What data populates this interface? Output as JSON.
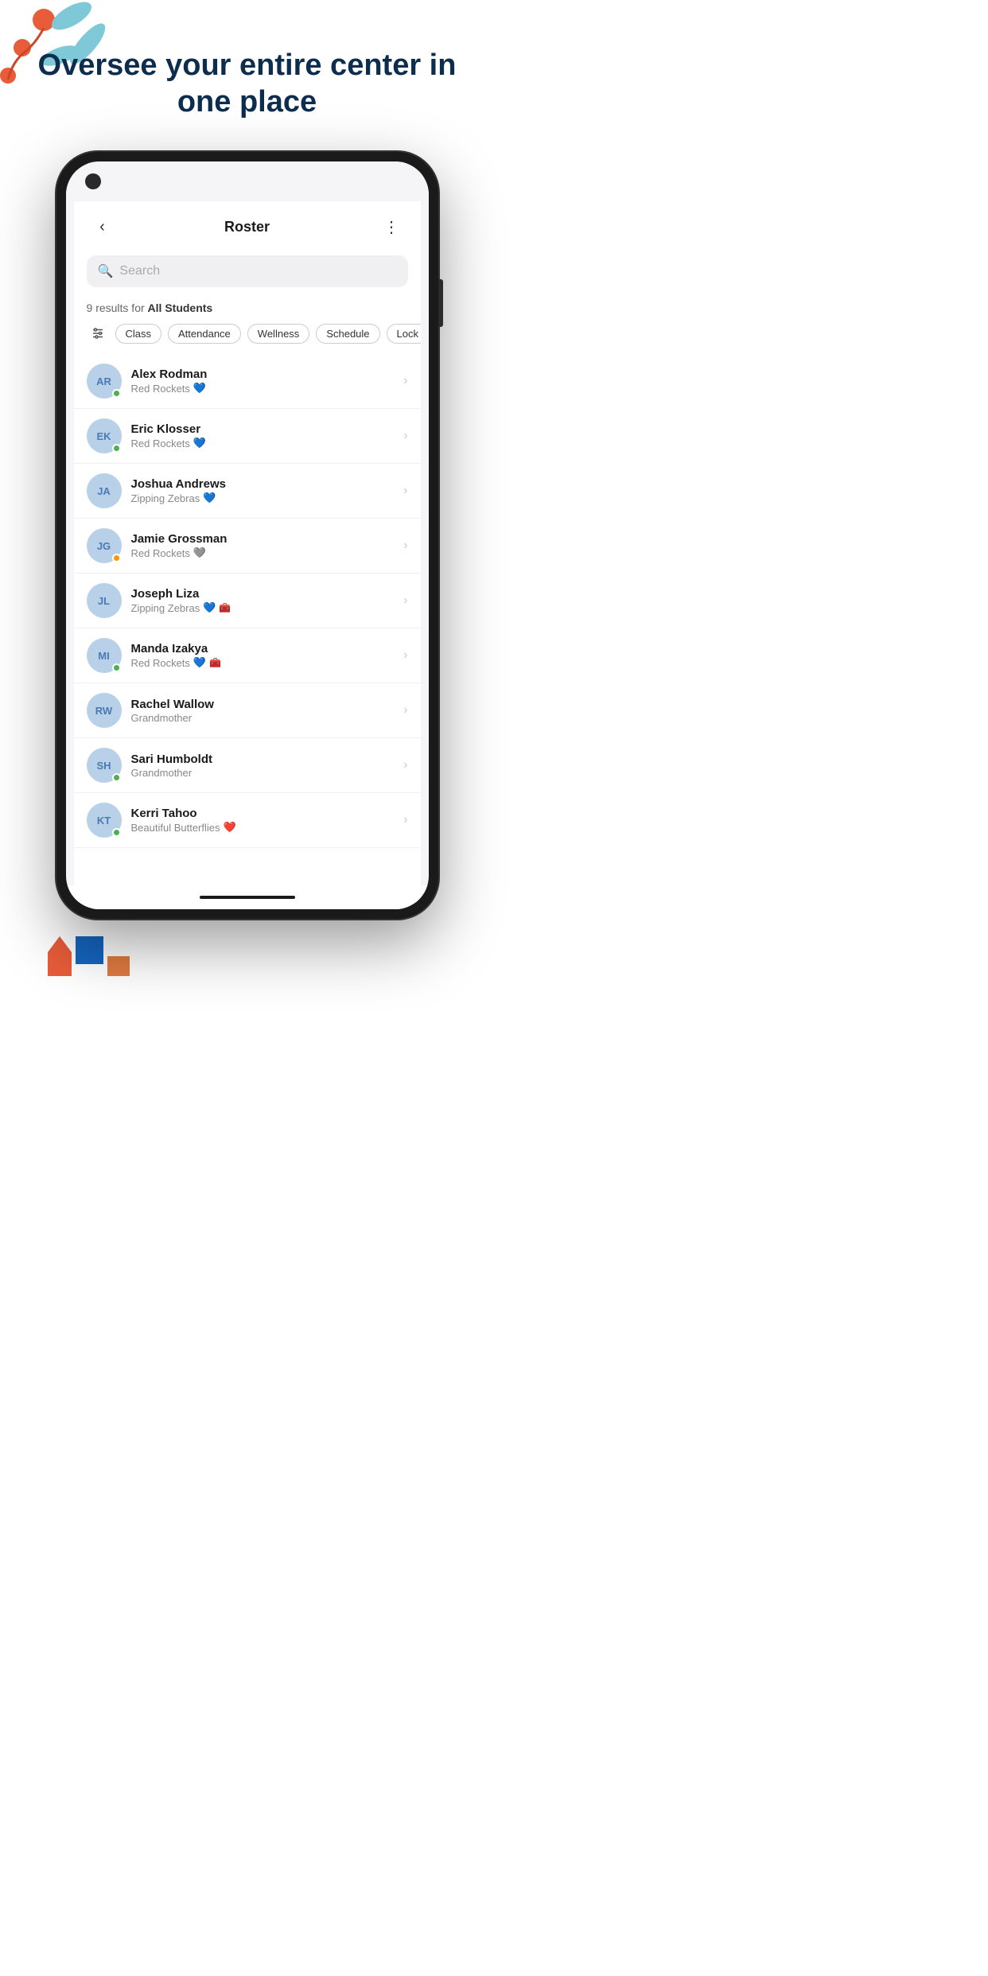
{
  "hero": {
    "title": "Oversee your entire center in one place"
  },
  "header": {
    "title": "Roster",
    "back_label": "‹",
    "more_label": "⋮"
  },
  "search": {
    "placeholder": "Search"
  },
  "results": {
    "count": "9",
    "text": "results for",
    "segment": "All Students"
  },
  "filters": [
    {
      "label": "Class"
    },
    {
      "label": "Attendance"
    },
    {
      "label": "Wellness"
    },
    {
      "label": "Schedule"
    },
    {
      "label": "Lock"
    }
  ],
  "students": [
    {
      "initials": "AR",
      "name": "Alex Rodman",
      "class": "Red Rockets",
      "status": "green",
      "has_heart": true,
      "has_medical": false
    },
    {
      "initials": "EK",
      "name": "Eric Klosser",
      "class": "Red Rockets",
      "status": "green",
      "has_heart": true,
      "has_medical": false
    },
    {
      "initials": "JA",
      "name": "Joshua Andrews",
      "class": "Zipping Zebras",
      "status": "none",
      "has_heart": true,
      "has_medical": false
    },
    {
      "initials": "JG",
      "name": "Jamie Grossman",
      "class": "Red Rockets",
      "status": "orange",
      "has_heart": false,
      "has_medical": false,
      "heart_grey": true
    },
    {
      "initials": "JL",
      "name": "Joseph Liza",
      "class": "Zipping Zebras",
      "status": "none",
      "has_heart": true,
      "has_medical": true
    },
    {
      "initials": "MI",
      "name": "Manda Izakya",
      "class": "Red Rockets",
      "status": "green",
      "has_heart": true,
      "has_medical": true
    },
    {
      "initials": "RW",
      "name": "Rachel Wallow",
      "class": "Grandmother",
      "status": "none",
      "has_heart": false,
      "has_medical": false
    },
    {
      "initials": "SH",
      "name": "Sari Humboldt",
      "class": "Grandmother",
      "status": "green",
      "has_heart": false,
      "has_medical": false
    },
    {
      "initials": "KT",
      "name": "Kerri Tahoo",
      "class": "Beautiful Butterflies",
      "status": "green",
      "has_heart": true,
      "heart_red": true,
      "has_medical": false
    }
  ]
}
